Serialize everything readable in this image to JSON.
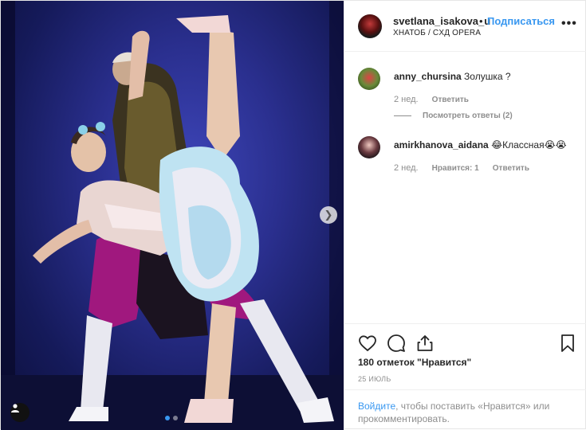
{
  "post": {
    "username": "svetlana_isakova_u",
    "bullet": "•",
    "follow_label": "Подписаться",
    "location": "ХНАТОБ / CХД OPERA",
    "more_icon": "more-options-icon"
  },
  "comments": [
    {
      "user": "anny_chursina",
      "text": "Золушка ?",
      "time": "2 нед.",
      "reply_label": "Ответить",
      "view_replies": "Посмотреть ответы (2)"
    },
    {
      "user": "amirkhanova_aidana",
      "text": "😂Классная😭😭",
      "time": "2 нед.",
      "likes_label": "Нравится: 1",
      "reply_label": "Ответить"
    }
  ],
  "footer": {
    "likes": "180 отметок \"Нравится\"",
    "date": "25 ИЮЛЬ",
    "login_link": "Войдите",
    "login_rest": ", чтобы поставить «Нравится» или прокомментировать."
  },
  "carousel": {
    "dots": 2,
    "active_index": 0
  },
  "colors": {
    "accent": "#3897f0",
    "muted": "#8e8e8e",
    "text": "#262626"
  }
}
